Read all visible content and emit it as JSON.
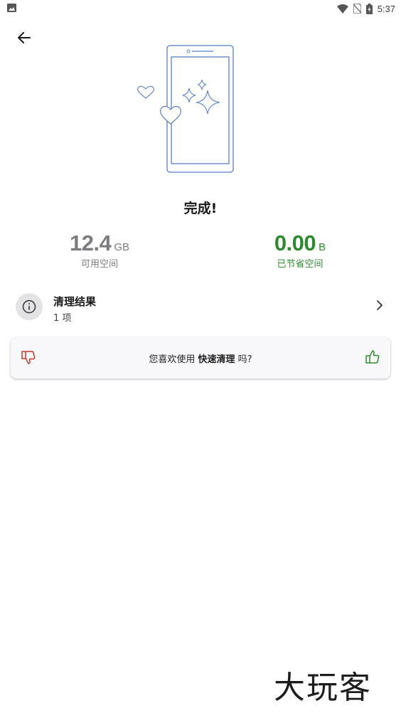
{
  "status_bar": {
    "left_icon": "image-icon",
    "icons": [
      "wifi-icon",
      "no-sim-icon",
      "battery-charging-icon"
    ],
    "time": "5:37"
  },
  "header": {
    "back_icon": "arrow-left-icon"
  },
  "illustration": {
    "icon": "phone-sparkle-hearts-illustration"
  },
  "title": "完成!",
  "stats": {
    "available": {
      "value": "12.4",
      "unit": "GB",
      "label": "可用空间"
    },
    "saved": {
      "value": "0.00",
      "unit": "B",
      "label": "已节省空间"
    }
  },
  "result": {
    "icon": "info-icon",
    "title": "清理结果",
    "subtitle": "1 项",
    "chevron_icon": "chevron-right-icon"
  },
  "feedback": {
    "prefix": "您喜欢使用 ",
    "feature": "快速清理",
    "suffix": " 吗?",
    "dislike_icon": "thumbs-down-icon",
    "like_icon": "thumbs-up-icon"
  },
  "colors": {
    "accent_green": "#2f8a2f",
    "dislike_red": "#c0392b",
    "illustration_blue": "#5b7fc7"
  },
  "watermark": "大玩客"
}
